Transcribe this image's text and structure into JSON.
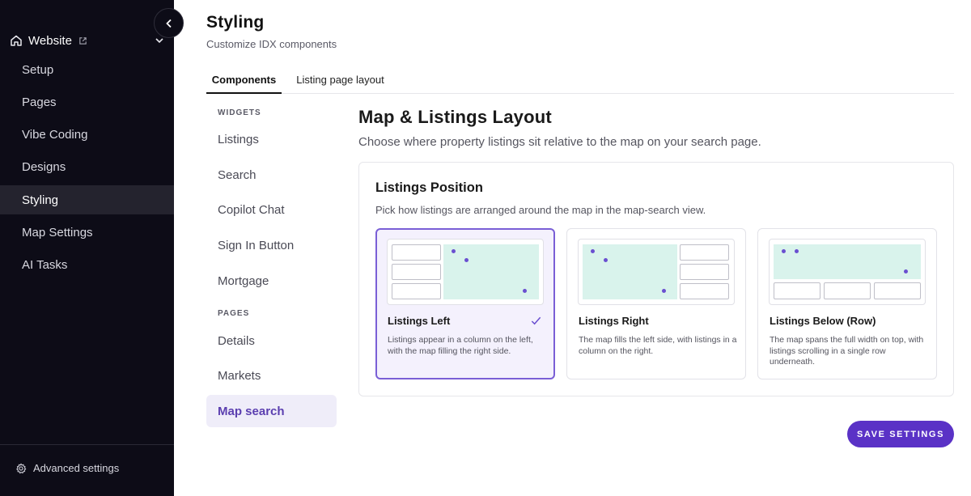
{
  "sidebar": {
    "site": {
      "label": "Website",
      "icon": "home-icon"
    },
    "items": [
      {
        "label": "Setup"
      },
      {
        "label": "Pages"
      },
      {
        "label": "Vibe Coding"
      },
      {
        "label": "Designs"
      },
      {
        "label": "Styling",
        "active": true
      },
      {
        "label": "Map Settings"
      },
      {
        "label": "AI Tasks"
      }
    ],
    "advanced": "Advanced settings"
  },
  "header": {
    "title": "Styling",
    "subtitle": "Customize IDX components"
  },
  "tabs": [
    {
      "label": "Components",
      "active": true
    },
    {
      "label": "Listing page layout"
    }
  ],
  "subnav": {
    "widgets_label": "WIDGETS",
    "widgets": [
      "Listings",
      "Search",
      "Copilot Chat",
      "Sign In Button",
      "Mortgage"
    ],
    "pages_label": "PAGES",
    "pages": [
      "Details",
      "Markets",
      "Map search"
    ],
    "active": "Map search"
  },
  "main": {
    "title": "Map & Listings Layout",
    "description": "Choose where property listings sit relative to the map on your search page.",
    "card": {
      "title": "Listings Position",
      "description": "Pick how listings are arranged around the map in the map-search view.",
      "options": [
        {
          "name": "Listings Left",
          "description": "Listings appear in a column on the left, with the map filling the right side.",
          "selected": true
        },
        {
          "name": "Listings Right",
          "description": "The map fills the left side, with listings in a column on the right.",
          "selected": false
        },
        {
          "name": "Listings Below (Row)",
          "description": "The map spans the full width on top, with listings scrolling in a single row underneath.",
          "selected": false
        }
      ]
    },
    "save_label": "SAVE SETTINGS"
  },
  "colors": {
    "sidebar_bg": "#0d0c17",
    "accent": "#5a32c6",
    "selected_border": "#7a5fd6",
    "map_fill": "#d9f3ec"
  }
}
